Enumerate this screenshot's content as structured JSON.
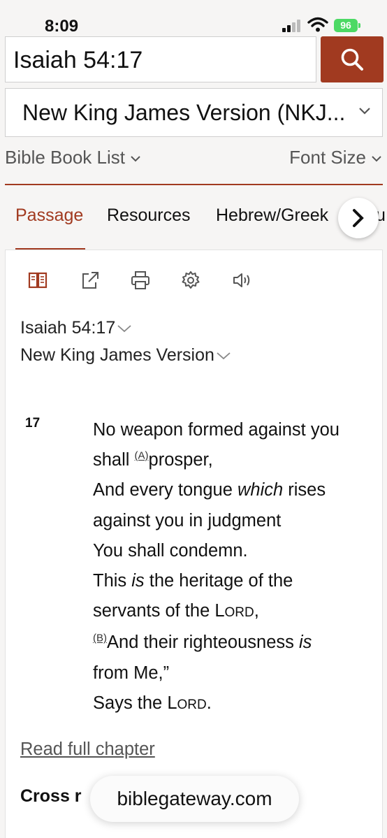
{
  "status": {
    "time": "8:09",
    "battery": "96"
  },
  "search": {
    "value": "Isaiah 54:17"
  },
  "version_select": {
    "value": "New King James Version (NKJ..."
  },
  "nav": {
    "book_list": "Bible Book List",
    "font_size": "Font Size"
  },
  "tabs": [
    {
      "label": "Passage",
      "active": true
    },
    {
      "label": "Resources"
    },
    {
      "label": "Hebrew/Greek"
    },
    {
      "label": "u"
    }
  ],
  "toolbar_icons": [
    "parallel-icon",
    "share-icon",
    "print-icon",
    "settings-icon",
    "audio-icon"
  ],
  "passage": {
    "reference": "Isaiah 54:17",
    "version": "New King James Version",
    "verse_number": "17",
    "lines": [
      [
        "No weapon formed against you"
      ],
      [
        "shall ",
        {
          "fn": "A"
        },
        "prosper,"
      ],
      [
        "And every tongue ",
        {
          "i": "which"
        },
        " rises"
      ],
      [
        "against you in judgment"
      ],
      [
        "You shall condemn."
      ],
      [
        "This ",
        {
          "i": "is"
        },
        " the heritage of the"
      ],
      [
        "servants of the ",
        {
          "sc": "Lord"
        },
        ","
      ],
      [
        {
          "fn": "B"
        },
        "And their righteousness ",
        {
          "i": "is"
        }
      ],
      [
        "from Me,”"
      ],
      [
        "Says the ",
        {
          "sc": "Lord"
        },
        "."
      ]
    ],
    "read_full": "Read full chapter",
    "cross_references": "Cross r"
  },
  "url_bar": {
    "domain": "biblegateway.com"
  },
  "colors": {
    "accent": "#a13a20",
    "background": "#f6f5f4"
  }
}
